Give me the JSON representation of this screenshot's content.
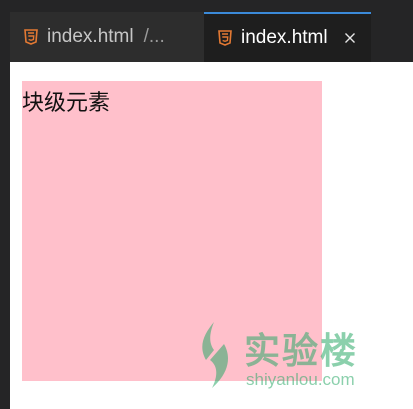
{
  "editor": {
    "tabs": [
      {
        "label": "index.html",
        "description": "/...",
        "icon": "html5-icon",
        "active": false
      },
      {
        "label": "index.html",
        "icon": "html5-icon",
        "active": true,
        "close_icon": "close-icon"
      }
    ]
  },
  "preview": {
    "block_text": "块级元素",
    "block_color": "#ffc0cb"
  },
  "watermark": {
    "title": "实验楼",
    "url": "shiyanlou.com",
    "color": "#2eaa6a"
  },
  "colors": {
    "tabbar_bg": "#252526",
    "active_tab_bg": "#1e1e1e",
    "active_tab_accent": "#3b8ad8",
    "html_icon": "#e37933"
  }
}
